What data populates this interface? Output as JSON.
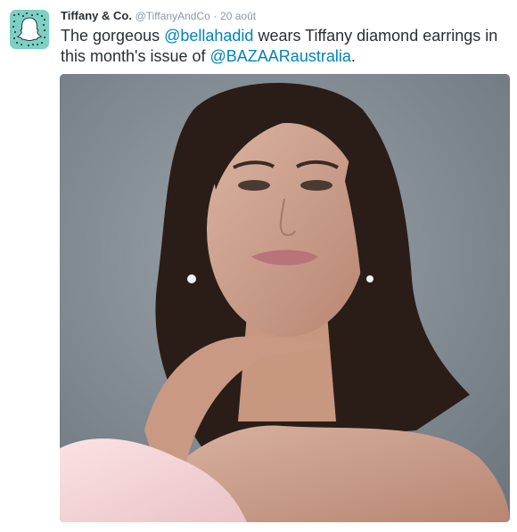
{
  "tweet": {
    "author_name": "Tiffany & Co.",
    "author_handle": "@TiffanyAndCo",
    "separator": "·",
    "date": "20 août",
    "text_part1": "The gorgeous ",
    "mention1": "@bellahadid",
    "text_part2": " wears Tiffany diamond earrings in this month's issue of ",
    "mention2": "@BAZAARaustralia",
    "text_part3": "."
  },
  "colors": {
    "mention": "#0084b4",
    "name": "#292f33",
    "meta": "#8899a6",
    "avatar_bg": "#7ecfc4"
  },
  "icons": {
    "avatar": "snapcode-ghost-icon"
  }
}
